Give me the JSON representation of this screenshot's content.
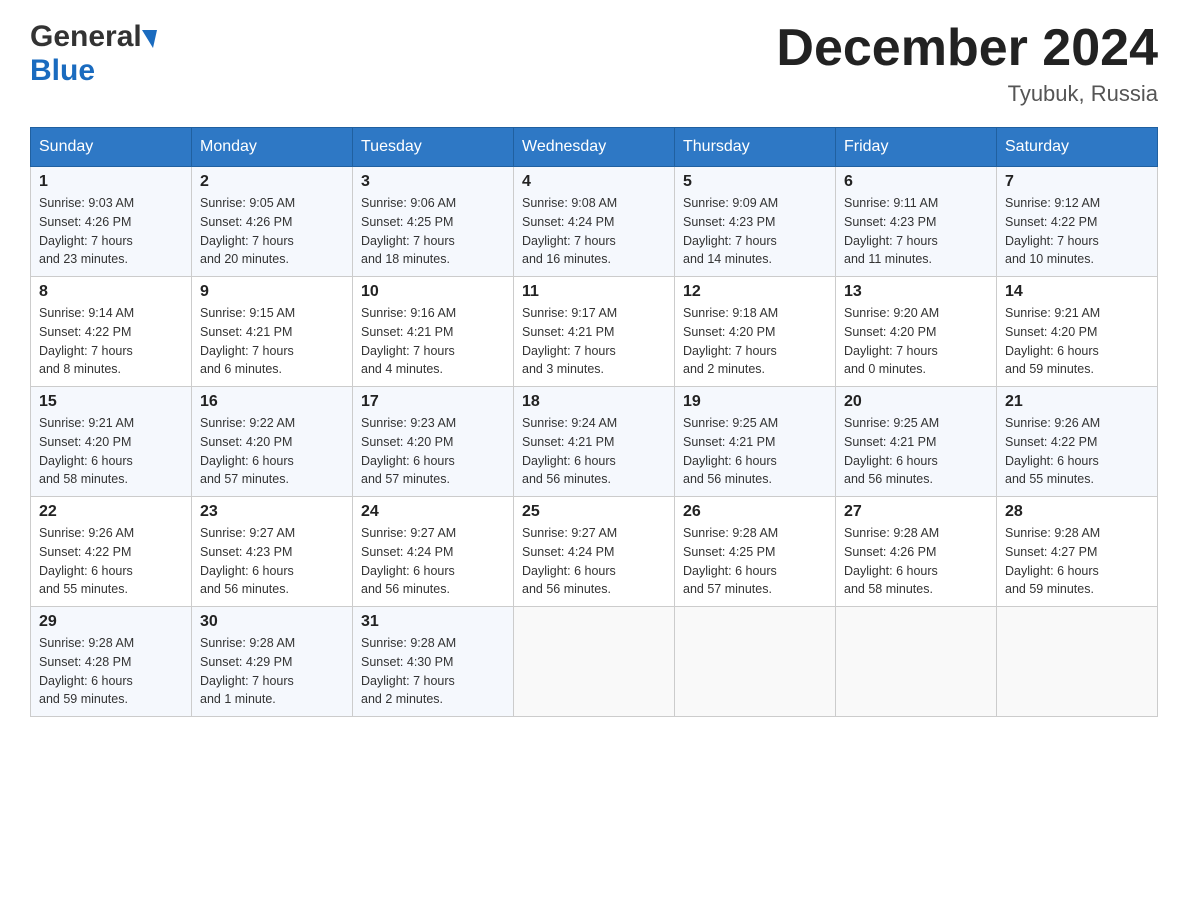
{
  "header": {
    "logo_general": "General",
    "logo_blue": "Blue",
    "month_title": "December 2024",
    "location": "Tyubuk, Russia"
  },
  "days_of_week": [
    "Sunday",
    "Monday",
    "Tuesday",
    "Wednesday",
    "Thursday",
    "Friday",
    "Saturday"
  ],
  "weeks": [
    [
      {
        "day": "1",
        "sunrise": "9:03 AM",
        "sunset": "4:26 PM",
        "daylight": "7 hours and 23 minutes."
      },
      {
        "day": "2",
        "sunrise": "9:05 AM",
        "sunset": "4:26 PM",
        "daylight": "7 hours and 20 minutes."
      },
      {
        "day": "3",
        "sunrise": "9:06 AM",
        "sunset": "4:25 PM",
        "daylight": "7 hours and 18 minutes."
      },
      {
        "day": "4",
        "sunrise": "9:08 AM",
        "sunset": "4:24 PM",
        "daylight": "7 hours and 16 minutes."
      },
      {
        "day": "5",
        "sunrise": "9:09 AM",
        "sunset": "4:23 PM",
        "daylight": "7 hours and 14 minutes."
      },
      {
        "day": "6",
        "sunrise": "9:11 AM",
        "sunset": "4:23 PM",
        "daylight": "7 hours and 11 minutes."
      },
      {
        "day": "7",
        "sunrise": "9:12 AM",
        "sunset": "4:22 PM",
        "daylight": "7 hours and 10 minutes."
      }
    ],
    [
      {
        "day": "8",
        "sunrise": "9:14 AM",
        "sunset": "4:22 PM",
        "daylight": "7 hours and 8 minutes."
      },
      {
        "day": "9",
        "sunrise": "9:15 AM",
        "sunset": "4:21 PM",
        "daylight": "7 hours and 6 minutes."
      },
      {
        "day": "10",
        "sunrise": "9:16 AM",
        "sunset": "4:21 PM",
        "daylight": "7 hours and 4 minutes."
      },
      {
        "day": "11",
        "sunrise": "9:17 AM",
        "sunset": "4:21 PM",
        "daylight": "7 hours and 3 minutes."
      },
      {
        "day": "12",
        "sunrise": "9:18 AM",
        "sunset": "4:20 PM",
        "daylight": "7 hours and 2 minutes."
      },
      {
        "day": "13",
        "sunrise": "9:20 AM",
        "sunset": "4:20 PM",
        "daylight": "7 hours and 0 minutes."
      },
      {
        "day": "14",
        "sunrise": "9:21 AM",
        "sunset": "4:20 PM",
        "daylight": "6 hours and 59 minutes."
      }
    ],
    [
      {
        "day": "15",
        "sunrise": "9:21 AM",
        "sunset": "4:20 PM",
        "daylight": "6 hours and 58 minutes."
      },
      {
        "day": "16",
        "sunrise": "9:22 AM",
        "sunset": "4:20 PM",
        "daylight": "6 hours and 57 minutes."
      },
      {
        "day": "17",
        "sunrise": "9:23 AM",
        "sunset": "4:20 PM",
        "daylight": "6 hours and 57 minutes."
      },
      {
        "day": "18",
        "sunrise": "9:24 AM",
        "sunset": "4:21 PM",
        "daylight": "6 hours and 56 minutes."
      },
      {
        "day": "19",
        "sunrise": "9:25 AM",
        "sunset": "4:21 PM",
        "daylight": "6 hours and 56 minutes."
      },
      {
        "day": "20",
        "sunrise": "9:25 AM",
        "sunset": "4:21 PM",
        "daylight": "6 hours and 56 minutes."
      },
      {
        "day": "21",
        "sunrise": "9:26 AM",
        "sunset": "4:22 PM",
        "daylight": "6 hours and 55 minutes."
      }
    ],
    [
      {
        "day": "22",
        "sunrise": "9:26 AM",
        "sunset": "4:22 PM",
        "daylight": "6 hours and 55 minutes."
      },
      {
        "day": "23",
        "sunrise": "9:27 AM",
        "sunset": "4:23 PM",
        "daylight": "6 hours and 56 minutes."
      },
      {
        "day": "24",
        "sunrise": "9:27 AM",
        "sunset": "4:24 PM",
        "daylight": "6 hours and 56 minutes."
      },
      {
        "day": "25",
        "sunrise": "9:27 AM",
        "sunset": "4:24 PM",
        "daylight": "6 hours and 56 minutes."
      },
      {
        "day": "26",
        "sunrise": "9:28 AM",
        "sunset": "4:25 PM",
        "daylight": "6 hours and 57 minutes."
      },
      {
        "day": "27",
        "sunrise": "9:28 AM",
        "sunset": "4:26 PM",
        "daylight": "6 hours and 58 minutes."
      },
      {
        "day": "28",
        "sunrise": "9:28 AM",
        "sunset": "4:27 PM",
        "daylight": "6 hours and 59 minutes."
      }
    ],
    [
      {
        "day": "29",
        "sunrise": "9:28 AM",
        "sunset": "4:28 PM",
        "daylight": "6 hours and 59 minutes."
      },
      {
        "day": "30",
        "sunrise": "9:28 AM",
        "sunset": "4:29 PM",
        "daylight": "7 hours and 1 minute."
      },
      {
        "day": "31",
        "sunrise": "9:28 AM",
        "sunset": "4:30 PM",
        "daylight": "7 hours and 2 minutes."
      },
      null,
      null,
      null,
      null
    ]
  ],
  "labels": {
    "sunrise": "Sunrise:",
    "sunset": "Sunset:",
    "daylight": "Daylight:"
  }
}
